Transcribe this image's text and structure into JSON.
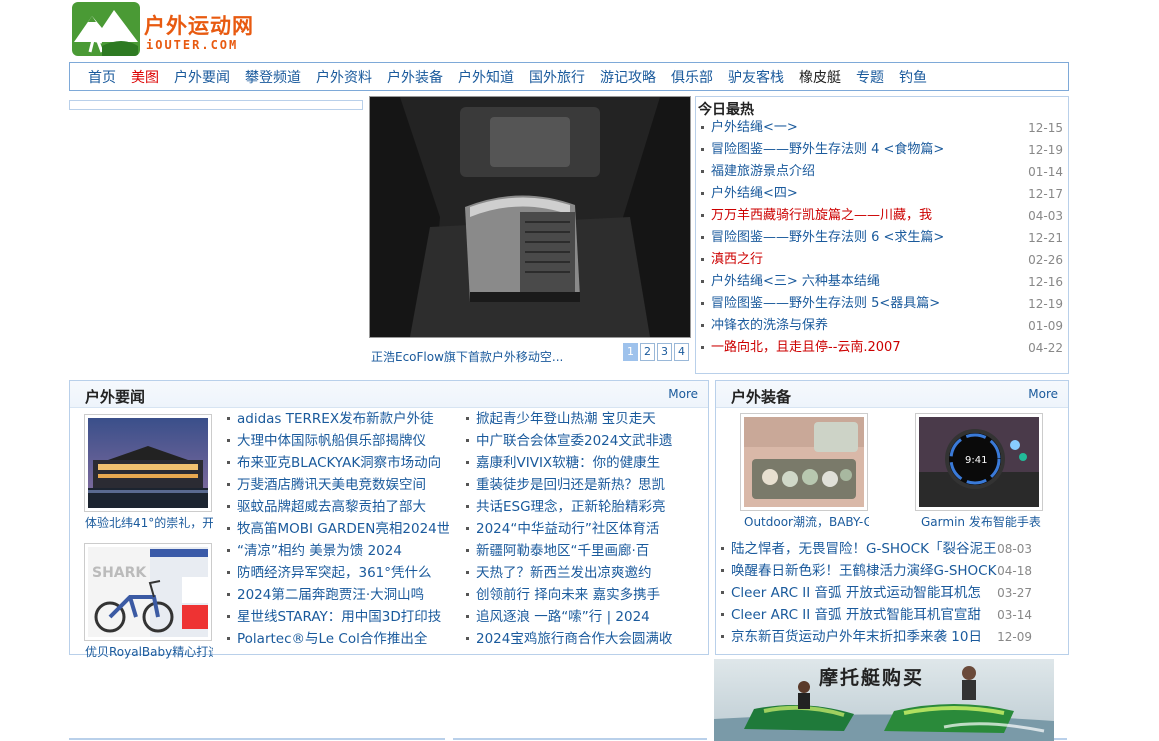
{
  "site": {
    "name_cn": "户外运动网",
    "name_en": "iOUTER.COM"
  },
  "nav": {
    "items": [
      {
        "label": "首页",
        "state": "normal"
      },
      {
        "label": "美图",
        "state": "active"
      },
      {
        "label": "户外要闻",
        "state": "normal"
      },
      {
        "label": "攀登频道",
        "state": "normal"
      },
      {
        "label": "户外资料",
        "state": "normal"
      },
      {
        "label": "户外装备",
        "state": "normal"
      },
      {
        "label": "户外知道",
        "state": "normal"
      },
      {
        "label": "国外旅行",
        "state": "normal"
      },
      {
        "label": "游记攻略",
        "state": "normal"
      },
      {
        "label": "俱乐部",
        "state": "normal"
      },
      {
        "label": "驴友客栈",
        "state": "normal"
      },
      {
        "label": "橡皮艇",
        "state": "dark"
      },
      {
        "label": "专题",
        "state": "normal"
      },
      {
        "label": "钓鱼",
        "state": "normal"
      }
    ]
  },
  "slider": {
    "caption": "正浩EcoFlow旗下首款户外移动空...",
    "pages": [
      "1",
      "2",
      "3",
      "4"
    ],
    "current_page": "1"
  },
  "hot": {
    "title": "今日最热",
    "items": [
      {
        "title": "户外结绳<一>",
        "date": "12-15",
        "red": false
      },
      {
        "title": "冒险图鉴——野外生存法则 4 <食物篇>",
        "date": "12-19",
        "red": false
      },
      {
        "title": "福建旅游景点介绍",
        "date": "01-14",
        "red": false
      },
      {
        "title": "户外结绳<四>",
        "date": "12-17",
        "red": false
      },
      {
        "title": "万万羊西藏骑行凯旋篇之——川藏，我",
        "date": "04-03",
        "red": true
      },
      {
        "title": "冒险图鉴——野外生存法则 6 <求生篇>",
        "date": "12-21",
        "red": false
      },
      {
        "title": "滇西之行",
        "date": "02-26",
        "red": true
      },
      {
        "title": "户外结绳<三> 六种基本结绳",
        "date": "12-16",
        "red": false
      },
      {
        "title": "冒险图鉴——野外生存法则 5<器具篇>",
        "date": "12-19",
        "red": false
      },
      {
        "title": "冲锋衣的洗涤与保养",
        "date": "01-09",
        "red": false
      },
      {
        "title": "一路向北，且走且停--云南.2007",
        "date": "04-22",
        "red": true
      }
    ]
  },
  "news": {
    "title": "户外要闻",
    "more": "More",
    "thumbs": [
      {
        "caption": "体验北纬41°的崇礼，开"
      },
      {
        "caption": "优贝RoyalBaby精心打造"
      }
    ],
    "col1": [
      "adidas TERREX发布新款户外徒",
      "大理中体国际帆船俱乐部揭牌仪",
      "布来亚克BLACKYAK洞察市场动向",
      "万斐酒店腾讯天美电竞数娱空间",
      "驱蚊品牌超威去高黎贡拍了部大",
      "牧高笛MOBI GARDEN亮相2024世",
      "“清凉”相约 美景为馈 2024",
      "防晒经济异军突起，361°凭什么",
      "2024第二届奔跑贾汪·大洞山鸣",
      "星世线STARAY：用中国3D打印技",
      "Polartec®与Le Col合作推出全"
    ],
    "col2": [
      "掀起青少年登山热潮 宝贝走天",
      "中广联合会体宣委2024文武非遗",
      "嘉康利VIVIX软糖：你的健康生",
      "重装徒步是回归还是新热？思凯",
      "共话ESG理念，正新轮胎精彩亮",
      "2024“中华益动行”社区体育活",
      "新疆阿勒泰地区“千里画廊·百",
      "天热了？新西兰发出凉爽邀约",
      "创领前行 择向未来 嘉实多携手",
      "追风逐浪 一路“嗦”行 | 2024",
      "2024宝鸡旅行商合作大会圆满收"
    ]
  },
  "gear": {
    "title": "户外装备",
    "more": "More",
    "thumbs": [
      {
        "caption": "Outdoor潮流，BABY-G"
      },
      {
        "caption": "Garmin 发布智能手表"
      }
    ],
    "items": [
      {
        "title": "陆之悍者，无畏冒险！G-SHOCK「裂谷泥王",
        "date": "08-03"
      },
      {
        "title": "唤醒春日新色彩！王鹤棣活力演绎G-SHOCK",
        "date": "04-18"
      },
      {
        "title": "Cleer ARC II 音弧 开放式运动智能耳机怎",
        "date": "03-27"
      },
      {
        "title": "Cleer ARC II 音弧 开放式智能耳机官宣甜",
        "date": "03-14"
      },
      {
        "title": "京东新百货运动户外年末折扣季来袭 10日",
        "date": "12-09"
      }
    ]
  },
  "ad": {
    "text": "摩托艇购买"
  },
  "colors": {
    "link": "#1a5a9c",
    "active_nav": "#dd0000",
    "hot_red": "#cc0000",
    "logo_orange": "#e85a10",
    "logo_green": "#4a9a35",
    "border": "#b9d0ea"
  }
}
